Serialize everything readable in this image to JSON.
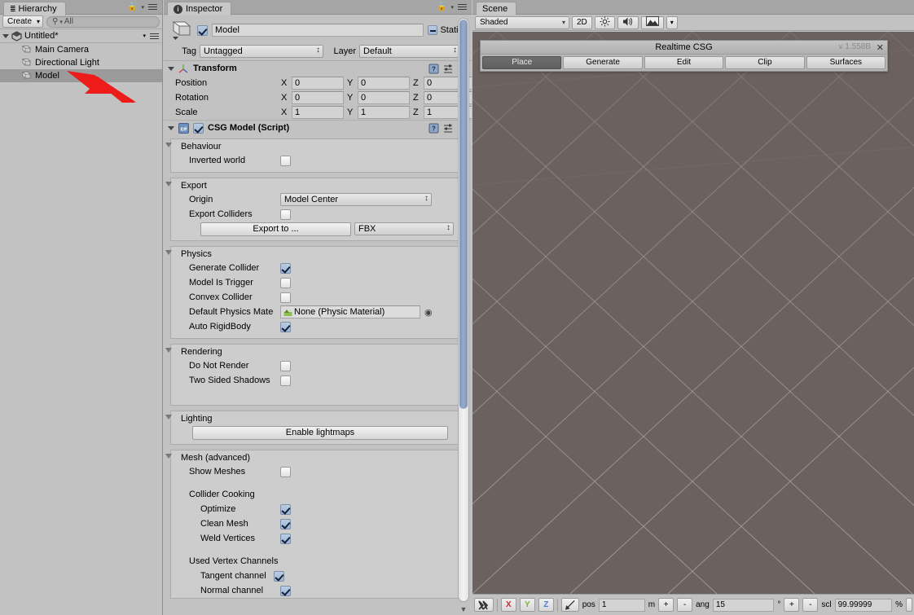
{
  "hierarchy": {
    "tab_label": "Hierarchy",
    "tab_icon": "hierarchy-icon",
    "create_label": "Create",
    "search_placeholder": "All",
    "search_value": "",
    "search_icon": "search-icon",
    "scene_name": "Untitled*",
    "items": [
      {
        "label": "Main Camera",
        "selected": false
      },
      {
        "label": "Directional Light",
        "selected": false
      },
      {
        "label": "Model",
        "selected": true
      }
    ]
  },
  "inspector": {
    "tab_label": "Inspector",
    "tab_icon": "info-icon",
    "object_enabled": true,
    "object_name": "Model",
    "static_label": "Static",
    "tag_label": "Tag",
    "tag_value": "Untagged",
    "layer_label": "Layer",
    "layer_value": "Default",
    "transform": {
      "title": "Transform",
      "rows": [
        {
          "label": "Position",
          "x": "0",
          "y": "0",
          "z": "0"
        },
        {
          "label": "Rotation",
          "x": "0",
          "y": "0",
          "z": "0"
        },
        {
          "label": "Scale",
          "x": "1",
          "y": "1",
          "z": "1"
        }
      ],
      "axis_labels": [
        "X",
        "Y",
        "Z"
      ]
    },
    "csg_model": {
      "title": "CSG Model (Script)",
      "enabled": true,
      "behaviour": {
        "title": "Behaviour",
        "inverted_world_label": "Inverted world",
        "inverted_world": false
      },
      "export": {
        "title": "Export",
        "origin_label": "Origin",
        "origin_value": "Model Center",
        "export_colliders_label": "Export Colliders",
        "export_colliders": false,
        "export_button": "Export to ...",
        "format_value": "FBX"
      },
      "physics": {
        "title": "Physics",
        "generate_collider_label": "Generate Collider",
        "generate_collider": true,
        "model_is_trigger_label": "Model Is Trigger",
        "model_is_trigger": false,
        "convex_collider_label": "Convex Collider",
        "convex_collider": false,
        "default_physics_material_label": "Default Physics Mate",
        "default_physics_material_value": "None (Physic Material)",
        "auto_rigidbody_label": "Auto RigidBody",
        "auto_rigidbody": true
      },
      "rendering": {
        "title": "Rendering",
        "do_not_render_label": "Do Not Render",
        "do_not_render": false,
        "two_sided_shadows_label": "Two Sided Shadows",
        "two_sided_shadows": false
      },
      "lighting": {
        "title": "Lighting",
        "enable_lightmaps_button": "Enable lightmaps"
      },
      "mesh": {
        "title": "Mesh (advanced)",
        "show_meshes_label": "Show Meshes",
        "show_meshes": false,
        "collider_cooking_label": "Collider Cooking",
        "optimize_label": "Optimize",
        "optimize": true,
        "clean_mesh_label": "Clean Mesh",
        "clean_mesh": true,
        "weld_vertices_label": "Weld Vertices",
        "weld_vertices": true,
        "used_vertex_channels_label": "Used Vertex Channels",
        "tangent_channel_label": "Tangent channel",
        "tangent_channel": true,
        "normal_channel_label": "Normal channel",
        "normal_channel": true
      }
    }
  },
  "scene": {
    "tab_label": "Scene",
    "toolbar": {
      "draw_mode": "Shaded",
      "two_d_label": "2D",
      "lighting_icon": "sun-icon",
      "audio_icon": "speaker-icon",
      "effects_icon": "image-icon"
    },
    "viewport": {
      "background_color": "#6b625f",
      "grid_color": "#8e8784"
    },
    "status": {
      "grid_icon": "grid-snap-icon",
      "axis_x": "X",
      "axis_y": "Y",
      "axis_z": "Z",
      "snap_icon": "snap-arrow-icon",
      "pos_label": "pos",
      "pos_value": "1",
      "pos_unit": "m",
      "plus_label": "+",
      "minus_label": "-",
      "ang_label": "ang",
      "ang_value": "15",
      "ang_unit": "°",
      "scl_label": "scl",
      "scl_value": "99.99999",
      "scl_unit": "%"
    }
  },
  "csg_window": {
    "title": "Realtime CSG",
    "version": "v 1.558B",
    "close_icon": "close-icon",
    "tabs": [
      {
        "label": "Place",
        "active": true
      },
      {
        "label": "Generate",
        "active": false
      },
      {
        "label": "Edit",
        "active": false
      },
      {
        "label": "Clip",
        "active": false
      },
      {
        "label": "Surfaces",
        "active": false
      }
    ]
  },
  "annotation": {
    "arrow_color": "#ee1b1b",
    "arrow_target": "Model"
  }
}
